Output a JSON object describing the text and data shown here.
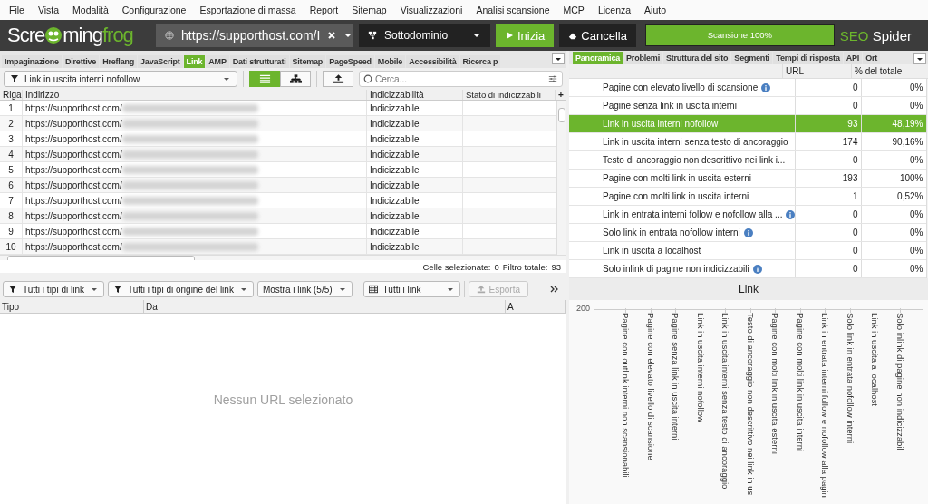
{
  "menu": [
    "File",
    "Vista",
    "Modalità",
    "Configurazione",
    "Esportazione di massa",
    "Report",
    "Sitemap",
    "Visualizzazioni",
    "Analisi scansione",
    "MCP",
    "Licenza",
    "Aiuto"
  ],
  "toolbar": {
    "logo_a": "Scre",
    "logo_b": "ming",
    "logo_c": "frog",
    "url": "https://supporthost.com/I",
    "mode": "Sottodominio",
    "start": "Inizia",
    "cancel": "Cancella",
    "progress": {
      "label": "Scansione 100%",
      "level": 1
    },
    "product_a": "SEO",
    "product_b": "Spider"
  },
  "left_tabs": [
    {
      "label": "Impaginazione",
      "selected": false
    },
    {
      "label": "Direttive",
      "selected": false
    },
    {
      "label": "Hreflang",
      "selected": false
    },
    {
      "label": "JavaScript",
      "selected": false
    },
    {
      "label": "Link",
      "selected": true
    },
    {
      "label": "AMP",
      "selected": false
    },
    {
      "label": "Dati strutturati",
      "selected": false
    },
    {
      "label": "Sitemap",
      "selected": false
    },
    {
      "label": "PageSpeed",
      "selected": false
    },
    {
      "label": "Mobile",
      "selected": false
    },
    {
      "label": "Accessibilità",
      "selected": false
    },
    {
      "label": "Ricerca p",
      "selected": false
    }
  ],
  "filter": {
    "value": "Link in uscita interni nofollow"
  },
  "view_toggles": [
    {
      "kind": "list",
      "selected": true
    },
    {
      "kind": "tree",
      "selected": false
    }
  ],
  "search": {
    "placeholder": "Cerca..."
  },
  "table": {
    "add_column": "+",
    "columns": [
      "Riga",
      "Indirizzo",
      "Indicizzabilità",
      "Stato di indicizzabili"
    ],
    "rows": [
      {
        "n": "1",
        "url": "https://supporthost.com/",
        "indexability": "Indicizzabile"
      },
      {
        "n": "2",
        "url": "https://supporthost.com/",
        "indexability": "Indicizzabile"
      },
      {
        "n": "3",
        "url": "https://supporthost.com/",
        "indexability": "Indicizzabile"
      },
      {
        "n": "4",
        "url": "https://supporthost.com/",
        "indexability": "Indicizzabile"
      },
      {
        "n": "5",
        "url": "https://supporthost.com/",
        "indexability": "Indicizzabile"
      },
      {
        "n": "6",
        "url": "https://supporthost.com/",
        "indexability": "Indicizzabile"
      },
      {
        "n": "7",
        "url": "https://supporthost.com/",
        "indexability": "Indicizzabile"
      },
      {
        "n": "8",
        "url": "https://supporthost.com/",
        "indexability": "Indicizzabile"
      },
      {
        "n": "9",
        "url": "https://supporthost.com/",
        "indexability": "Indicizzabile"
      },
      {
        "n": "10",
        "url": "https://supporthost.com/",
        "indexability": "Indicizzabile"
      }
    ]
  },
  "status": {
    "cells_label": "Celle selezionate:",
    "cells": "0",
    "total_label": "Filtro totale:",
    "total": "93"
  },
  "bottom_toolbar": {
    "dropdowns": [
      {
        "kind": "filter",
        "label": "Tutti i tipi di link"
      },
      {
        "kind": "filter",
        "label": "Tutti i tipi di origine del link"
      },
      {
        "kind": "plain",
        "label": "Mostra i link (5/5)"
      },
      {
        "kind": "table",
        "label": "Tutti i link"
      }
    ],
    "export": {
      "label": "Esporta",
      "disabled": true
    }
  },
  "bottom_table": {
    "columns": [
      "Tipo",
      "Da",
      "A"
    ],
    "empty_message": "Nessun URL selezionato"
  },
  "right_tabs": [
    {
      "label": "Panoramica",
      "selected": true
    },
    {
      "label": "Problemi",
      "selected": false
    },
    {
      "label": "Struttura del sito",
      "selected": false
    },
    {
      "label": "Segmenti",
      "selected": false
    },
    {
      "label": "Tempi di risposta",
      "selected": false
    },
    {
      "label": "API",
      "selected": false
    },
    {
      "label": "Ort",
      "selected": false
    }
  ],
  "overview": {
    "columns": [
      "URL",
      "% del totale"
    ],
    "rows": [
      {
        "label": "Pagine con elevato livello di scansione",
        "info": true,
        "urls": "0",
        "pct": "0%",
        "selected": false
      },
      {
        "label": "Pagine senza link in uscita interni",
        "info": false,
        "urls": "0",
        "pct": "0%",
        "selected": false
      },
      {
        "label": "Link in uscita interni nofollow",
        "info": false,
        "urls": "93",
        "pct": "48,19%",
        "selected": true
      },
      {
        "label": "Link in uscita interni senza testo di ancoraggio",
        "info": false,
        "urls": "174",
        "pct": "90,16%",
        "selected": false
      },
      {
        "label": "Testo di ancoraggio non descrittivo nei link i...",
        "info": false,
        "urls": "0",
        "pct": "0%",
        "selected": false
      },
      {
        "label": "Pagine con molti link in uscita esterni",
        "info": false,
        "urls": "193",
        "pct": "100%",
        "selected": false
      },
      {
        "label": "Pagine con molti link in uscita interni",
        "info": false,
        "urls": "1",
        "pct": "0,52%",
        "selected": false
      },
      {
        "label": "Link in entrata interni follow e nofollow alla ...",
        "info": true,
        "urls": "0",
        "pct": "0%",
        "selected": false
      },
      {
        "label": "Solo link in entrata nofollow interni",
        "info": true,
        "urls": "0",
        "pct": "0%",
        "selected": false
      },
      {
        "label": "Link in uscita a localhost",
        "info": false,
        "urls": "0",
        "pct": "0%",
        "selected": false
      },
      {
        "label": "Solo inlink di pagine non indicizzabili",
        "info": true,
        "urls": "0",
        "pct": "0%",
        "selected": false
      }
    ]
  },
  "chart": {
    "title": "Link",
    "y_tick": "200",
    "categories": [
      "Pagine con outlink interni non scansionabili",
      "Pagine con elevato livello di scansione",
      "Pagine senza link in uscita interni",
      "Link in uscita interni nofollow",
      "Link in uscita interni senza testo di ancoraggio",
      "Testo di ancoraggio non descrittivo nei link in us",
      "Pagine con molti link in uscita esterni",
      "Pagine con molti link in uscita interni",
      "Link in entrata interni follow e nofollow alla pagin",
      "Solo link in entrata nofollow interni",
      "Link in uscita a localhost",
      "Solo inlink di pagine non indicizzabili"
    ]
  }
}
